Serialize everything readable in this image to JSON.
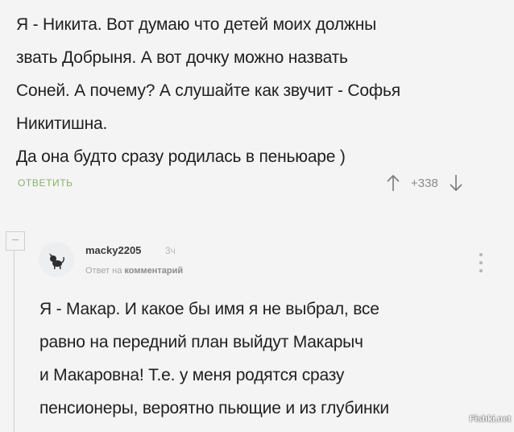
{
  "comment": {
    "lines": [
      "Я - Никита. Вот думаю что детей моих должны",
      "звать Добрыня. А вот дочку можно назвать",
      "Соней. А почему? А слушайте как звучит - Софья",
      "Никитишна.",
      "Да она будто сразу родилась в пеньюаре )"
    ],
    "reply_label": "ответить",
    "score": "+338"
  },
  "reply": {
    "username": "macky2205",
    "time": "3ч",
    "meta_prefix": "Ответ на",
    "meta_target": "комментарий",
    "lines": [
      "Я - Макар. И какое бы имя я не выбрал, все",
      "равно на передний план выйдут Макарыч",
      "и Макаровна! Т.е. у меня родятся сразу",
      "пенсионеры, вероятно пьющие и из глубинки"
    ]
  },
  "icons": {
    "upvote": "arrow-up-icon",
    "downvote": "arrow-down-icon",
    "collapse": "minus-icon",
    "more": "more-vertical-icon"
  },
  "colors": {
    "reply_link": "#8bb06b",
    "background": "#f4f4f4"
  },
  "watermark": "Fishki.net"
}
